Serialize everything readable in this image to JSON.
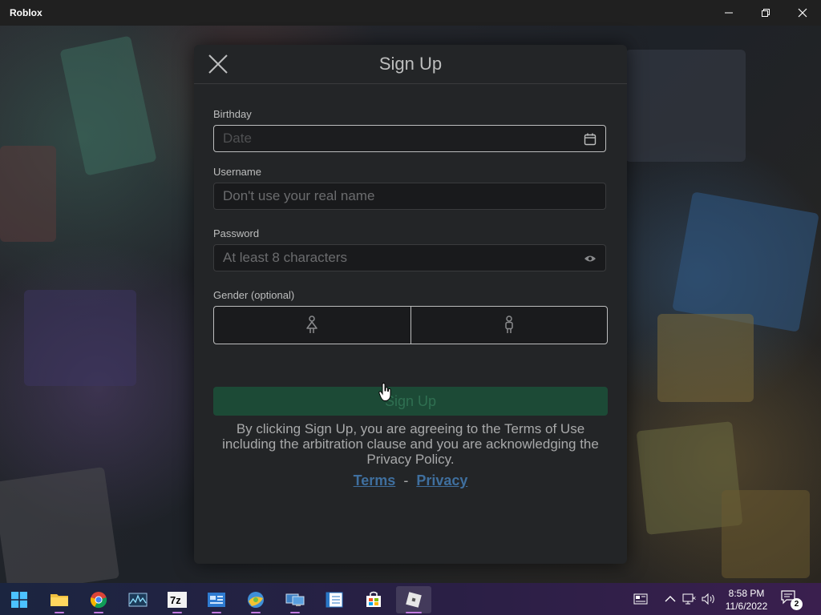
{
  "window": {
    "title": "Roblox"
  },
  "modal": {
    "title": "Sign Up",
    "birthday": {
      "label": "Birthday",
      "placeholder": "Date"
    },
    "username": {
      "label": "Username",
      "placeholder": "Don't use your real name"
    },
    "password": {
      "label": "Password",
      "placeholder": "At least 8 characters"
    },
    "gender": {
      "label": "Gender (optional)"
    },
    "signup_button": "Sign Up",
    "legal_text": "By clicking Sign Up, you are agreeing to the Terms of Use including the arbitration clause and you are acknowledging the Privacy Policy.",
    "links": {
      "terms": "Terms",
      "separator": "-",
      "privacy": "Privacy"
    }
  },
  "taskbar": {
    "apps": [
      "start-icon",
      "file-explorer-icon",
      "chrome-icon",
      "resource-monitor-icon",
      "7zip-icon",
      "control-panel-icon",
      "browser-icon",
      "remote-desktop-icon",
      "notepad-icon",
      "microsoft-store-icon",
      "roblox-icon"
    ],
    "clock": {
      "time": "8:58 PM",
      "date": "11/6/2022"
    },
    "notifications": {
      "count": "2"
    }
  },
  "colors": {
    "modal_bg": "#232527",
    "signup_disabled": "#1c4a36",
    "link": "#3f6f9e"
  }
}
